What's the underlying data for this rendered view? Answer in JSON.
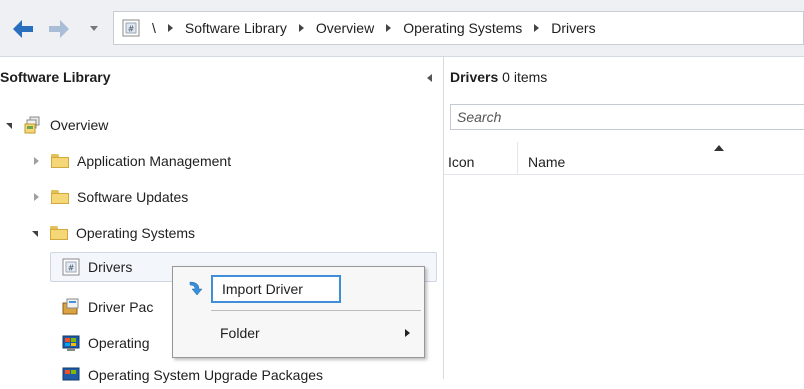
{
  "breadcrumb": {
    "root": "\\",
    "items": [
      "Software Library",
      "Overview",
      "Operating Systems",
      "Drivers"
    ]
  },
  "left_pane": {
    "title": "Software Library",
    "tree": {
      "overview": "Overview",
      "application_management": "Application Management",
      "software_updates": "Software Updates",
      "operating_systems": "Operating Systems",
      "drivers": "Drivers",
      "driver_packages": "Driver Pac",
      "operating_system_images": "Operating",
      "os_upgrade_packages": "Operating System Upgrade Packages"
    }
  },
  "right_pane": {
    "title": "Drivers",
    "count": "0 items",
    "search_placeholder": "Search",
    "columns": [
      "Icon",
      "Name"
    ]
  },
  "context_menu": {
    "items": [
      "Import Driver",
      "Folder"
    ]
  },
  "colors": {
    "accent": "#3e8ed8",
    "nav_arrow": "#2a6fbd",
    "folder": "#f5d778"
  }
}
